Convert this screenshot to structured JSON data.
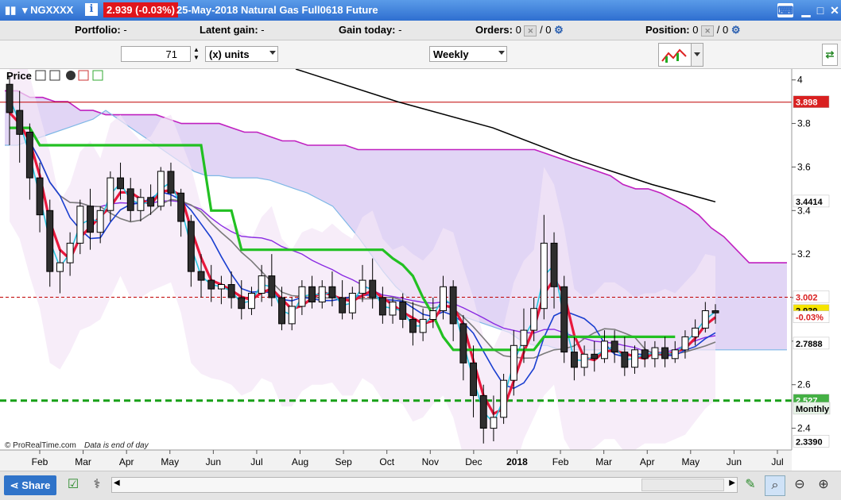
{
  "title_bar": {
    "symbol": "NGXXXX",
    "price_badge": "2.939 (-0.03%)",
    "description": "25-May-2018 Natural Gas Full0618 Future"
  },
  "account": {
    "portfolio_label": "Portfolio:",
    "portfolio_value": "-",
    "latent_label": "Latent gain:",
    "latent_value": "-",
    "today_label": "Gain today:",
    "today_value": "-",
    "orders_label": "Orders:",
    "orders_value": "0",
    "orders_slash": "/ 0",
    "position_label": "Position:",
    "position_value": "0",
    "position_slash": "/ 0"
  },
  "order_bar": {
    "quantity": "71",
    "units": "(x) units",
    "period": "Weekly"
  },
  "panel": {
    "title": "Price",
    "copyright": "© ProRealTime.com",
    "eod_note": "Data is end of day"
  },
  "chart_data": {
    "type": "candlestick",
    "ylim": [
      2.3,
      4.05
    ],
    "y_ticks": [
      "4",
      "3.8",
      "3.6",
      "3.4",
      "3.2",
      "3",
      "2.8",
      "2.6",
      "2.4"
    ],
    "x_labels": [
      "Feb",
      "Mar",
      "Apr",
      "May",
      "Jun",
      "Jul",
      "Aug",
      "Sep",
      "Oct",
      "Nov",
      "Dec",
      "2018",
      "Feb",
      "Mar",
      "Apr",
      "May",
      "Jun",
      "Jul"
    ],
    "horizontal_lines": [
      {
        "value": 3.898,
        "color": "#c00000",
        "style": "solid"
      },
      {
        "value": 3.002,
        "color": "#c00000",
        "style": "dashed"
      },
      {
        "value": 2.527,
        "color": "#18a018",
        "style": "dashed"
      }
    ],
    "price_labels": [
      {
        "text": "3.898",
        "bg": "#d92020",
        "fg": "#ffffff"
      },
      {
        "text": "3.4414",
        "bg": "#ffffff",
        "fg": "#000000"
      },
      {
        "text": "3.002",
        "bg": "#ffffff",
        "fg": "#d92020"
      },
      {
        "text": "2.939",
        "bg": "#f5e400",
        "fg": "#000000"
      },
      {
        "text": "-0.03%",
        "bg": "#ffffff",
        "fg": "#d92020"
      },
      {
        "text": "2.7888",
        "bg": "#ffffff",
        "fg": "#000000"
      },
      {
        "text": "2.527",
        "bg": "#44b044",
        "fg": "#ffffff"
      },
      {
        "text": "Monthly",
        "bg": "#e8f4e8",
        "fg": "#000000"
      },
      {
        "text": "2.3390",
        "bg": "#ffffff",
        "fg": "#000000"
      }
    ],
    "candles": [
      {
        "o": 3.98,
        "h": 4.02,
        "c": 3.85,
        "l": 3.7
      },
      {
        "o": 3.86,
        "h": 3.95,
        "c": 3.75,
        "l": 3.62
      },
      {
        "o": 3.76,
        "h": 3.8,
        "c": 3.55,
        "l": 3.45
      },
      {
        "o": 3.55,
        "h": 3.62,
        "c": 3.38,
        "l": 3.3
      },
      {
        "o": 3.4,
        "h": 3.45,
        "c": 3.12,
        "l": 3.05
      },
      {
        "o": 3.12,
        "h": 3.22,
        "c": 3.16,
        "l": 3.02
      },
      {
        "o": 3.16,
        "h": 3.3,
        "c": 3.25,
        "l": 3.1
      },
      {
        "o": 3.25,
        "h": 3.45,
        "c": 3.42,
        "l": 3.2
      },
      {
        "o": 3.42,
        "h": 3.5,
        "c": 3.3,
        "l": 3.22
      },
      {
        "o": 3.3,
        "h": 3.42,
        "c": 3.4,
        "l": 3.25
      },
      {
        "o": 3.4,
        "h": 3.58,
        "c": 3.55,
        "l": 3.35
      },
      {
        "o": 3.55,
        "h": 3.62,
        "c": 3.5,
        "l": 3.45
      },
      {
        "o": 3.5,
        "h": 3.55,
        "c": 3.4,
        "l": 3.35
      },
      {
        "o": 3.4,
        "h": 3.5,
        "c": 3.46,
        "l": 3.35
      },
      {
        "o": 3.46,
        "h": 3.52,
        "c": 3.42,
        "l": 3.38
      },
      {
        "o": 3.42,
        "h": 3.6,
        "c": 3.58,
        "l": 3.4
      },
      {
        "o": 3.58,
        "h": 3.62,
        "c": 3.48,
        "l": 3.42
      },
      {
        "o": 3.48,
        "h": 3.5,
        "c": 3.35,
        "l": 3.28
      },
      {
        "o": 3.35,
        "h": 3.38,
        "c": 3.12,
        "l": 3.05
      },
      {
        "o": 3.12,
        "h": 3.2,
        "c": 3.08,
        "l": 3.0
      },
      {
        "o": 3.08,
        "h": 3.15,
        "c": 3.04,
        "l": 2.98
      },
      {
        "o": 3.04,
        "h": 3.1,
        "c": 3.06,
        "l": 2.97
      },
      {
        "o": 3.06,
        "h": 3.12,
        "c": 3.0,
        "l": 2.95
      },
      {
        "o": 3.0,
        "h": 3.08,
        "c": 2.95,
        "l": 2.9
      },
      {
        "o": 2.95,
        "h": 3.05,
        "c": 3.02,
        "l": 2.92
      },
      {
        "o": 3.02,
        "h": 3.15,
        "c": 3.1,
        "l": 2.98
      },
      {
        "o": 3.1,
        "h": 3.2,
        "c": 3.0,
        "l": 2.96
      },
      {
        "o": 3.0,
        "h": 3.05,
        "c": 2.88,
        "l": 2.85
      },
      {
        "o": 2.88,
        "h": 3.0,
        "c": 2.96,
        "l": 2.85
      },
      {
        "o": 2.96,
        "h": 3.08,
        "c": 3.05,
        "l": 2.92
      },
      {
        "o": 3.05,
        "h": 3.1,
        "c": 2.98,
        "l": 2.95
      },
      {
        "o": 2.98,
        "h": 3.08,
        "c": 3.05,
        "l": 2.95
      },
      {
        "o": 3.05,
        "h": 3.12,
        "c": 3.0,
        "l": 2.96
      },
      {
        "o": 3.0,
        "h": 3.08,
        "c": 2.93,
        "l": 2.9
      },
      {
        "o": 2.93,
        "h": 3.05,
        "c": 3.02,
        "l": 2.9
      },
      {
        "o": 3.02,
        "h": 3.15,
        "c": 3.08,
        "l": 2.98
      },
      {
        "o": 3.08,
        "h": 3.18,
        "c": 3.0,
        "l": 2.95
      },
      {
        "o": 3.0,
        "h": 3.05,
        "c": 2.92,
        "l": 2.88
      },
      {
        "o": 2.92,
        "h": 3.0,
        "c": 2.98,
        "l": 2.88
      },
      {
        "o": 2.98,
        "h": 3.02,
        "c": 2.9,
        "l": 2.86
      },
      {
        "o": 2.9,
        "h": 2.98,
        "c": 2.84,
        "l": 2.78
      },
      {
        "o": 2.84,
        "h": 2.95,
        "c": 2.9,
        "l": 2.8
      },
      {
        "o": 2.9,
        "h": 3.0,
        "c": 2.94,
        "l": 2.86
      },
      {
        "o": 2.94,
        "h": 3.1,
        "c": 3.05,
        "l": 2.9
      },
      {
        "o": 3.05,
        "h": 3.08,
        "c": 2.88,
        "l": 2.8
      },
      {
        "o": 2.88,
        "h": 2.92,
        "c": 2.7,
        "l": 2.62
      },
      {
        "o": 2.7,
        "h": 2.78,
        "c": 2.55,
        "l": 2.45
      },
      {
        "o": 2.55,
        "h": 2.6,
        "c": 2.4,
        "l": 2.33
      },
      {
        "o": 2.4,
        "h": 2.55,
        "c": 2.45,
        "l": 2.34
      },
      {
        "o": 2.45,
        "h": 2.65,
        "c": 2.62,
        "l": 2.42
      },
      {
        "o": 2.62,
        "h": 2.85,
        "c": 2.78,
        "l": 2.55
      },
      {
        "o": 2.78,
        "h": 2.95,
        "c": 2.85,
        "l": 2.7
      },
      {
        "o": 2.85,
        "h": 3.0,
        "c": 2.95,
        "l": 2.8
      },
      {
        "o": 2.95,
        "h": 3.38,
        "c": 3.25,
        "l": 2.9
      },
      {
        "o": 3.25,
        "h": 3.3,
        "c": 3.05,
        "l": 2.95
      },
      {
        "o": 3.05,
        "h": 3.1,
        "c": 2.75,
        "l": 2.7
      },
      {
        "o": 2.75,
        "h": 2.82,
        "c": 2.68,
        "l": 2.62
      },
      {
        "o": 2.68,
        "h": 2.78,
        "c": 2.74,
        "l": 2.64
      },
      {
        "o": 2.74,
        "h": 2.8,
        "c": 2.72,
        "l": 2.66
      },
      {
        "o": 2.72,
        "h": 2.85,
        "c": 2.8,
        "l": 2.7
      },
      {
        "o": 2.8,
        "h": 2.85,
        "c": 2.75,
        "l": 2.7
      },
      {
        "o": 2.75,
        "h": 2.82,
        "c": 2.68,
        "l": 2.64
      },
      {
        "o": 2.68,
        "h": 2.78,
        "c": 2.76,
        "l": 2.65
      },
      {
        "o": 2.76,
        "h": 2.8,
        "c": 2.72,
        "l": 2.68
      },
      {
        "o": 2.72,
        "h": 2.8,
        "c": 2.77,
        "l": 2.68
      },
      {
        "o": 2.77,
        "h": 2.82,
        "c": 2.72,
        "l": 2.68
      },
      {
        "o": 2.72,
        "h": 2.8,
        "c": 2.76,
        "l": 2.7
      },
      {
        "o": 2.76,
        "h": 2.85,
        "c": 2.82,
        "l": 2.72
      },
      {
        "o": 2.82,
        "h": 2.9,
        "c": 2.86,
        "l": 2.78
      },
      {
        "o": 2.86,
        "h": 2.98,
        "c": 2.94,
        "l": 2.84
      },
      {
        "o": 2.94,
        "h": 2.97,
        "c": 2.93,
        "l": 2.88
      }
    ]
  },
  "bottom_bar": {
    "share_label": "Share"
  }
}
